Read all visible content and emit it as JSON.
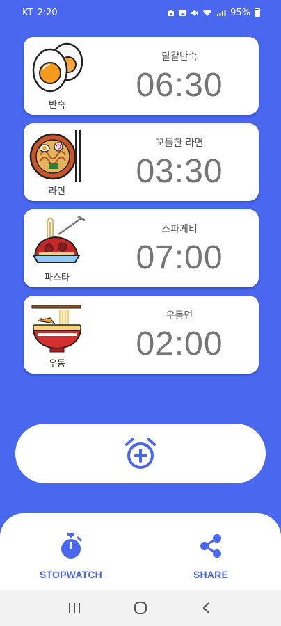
{
  "status_bar": {
    "carrier": "KT",
    "time": "2:20",
    "battery": "95%",
    "indicator_icons": [
      "camera-icon",
      "gallery-icon",
      "mute-icon",
      "wifi-icon",
      "signal-icon"
    ]
  },
  "timers": [
    {
      "food_label": "반숙",
      "name": "달걀반숙",
      "time": "06:30",
      "icon": "boiled-egg-icon"
    },
    {
      "food_label": "라면",
      "name": "꼬들한 라면",
      "time": "03:30",
      "icon": "ramen-icon"
    },
    {
      "food_label": "파스타",
      "name": "스파게티",
      "time": "07:00",
      "icon": "spaghetti-icon"
    },
    {
      "food_label": "우동",
      "name": "우동면",
      "time": "02:00",
      "icon": "udon-icon"
    }
  ],
  "add_button": {
    "icon": "alarm-add-icon"
  },
  "bottom_bar": {
    "stopwatch_label": "STOPWATCH",
    "share_label": "SHARE"
  },
  "colors": {
    "background": "#4a67f0",
    "accent": "#4a67f0",
    "card": "#ffffff",
    "time_text": "#757575"
  },
  "nav": [
    "recent-apps-icon",
    "home-icon",
    "back-icon"
  ]
}
